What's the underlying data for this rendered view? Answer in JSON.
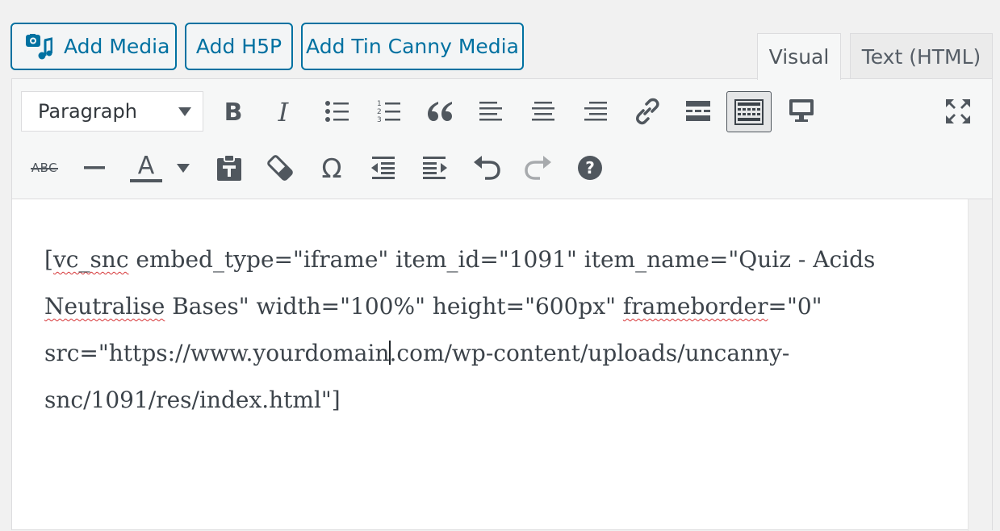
{
  "media_buttons": {
    "add_media": "Add Media",
    "add_h5p": "Add H5P",
    "add_tin_canny": "Add Tin Canny Media"
  },
  "tabs": {
    "visual": "Visual",
    "text": "Text (HTML)"
  },
  "toolbar": {
    "format_select": "Paragraph",
    "row1_icons": [
      "bold-icon",
      "italic-icon",
      "bulleted-list-icon",
      "numbered-list-icon",
      "blockquote-icon",
      "align-left-icon",
      "align-center-icon",
      "align-right-icon",
      "link-icon",
      "read-more-icon",
      "toolbar-toggle-icon",
      "fullscreen-preview-icon",
      "fullscreen-icon"
    ],
    "row2_icons": [
      "strikethrough-icon",
      "horizontal-line-icon",
      "text-color-icon",
      "text-color-dropdown-icon",
      "paste-as-text-icon",
      "clear-formatting-icon",
      "special-character-icon",
      "outdent-icon",
      "indent-icon",
      "undo-icon",
      "redo-icon",
      "help-icon"
    ],
    "strike_label": "ABC",
    "text_color_label": "A",
    "omega_label": "Ω",
    "help_label": "?"
  },
  "content": {
    "line1_a": "[",
    "line1_spell": "vc_snc",
    "line1_b": " embed_type=\"iframe\" item_id=\"1091\" item_name=\"Quiz - Acids",
    "line2_spell": "Neutralise",
    "line2_a": " Bases\" width=\"100%\" height=\"600px\" ",
    "line2_spell2": "frameborder",
    "line2_b": "=\"0\"",
    "line3_a": "src=\"https://www.yourdomain",
    "line3_b": ".com/wp-content/uploads/uncanny-",
    "line4": "snc/1091/res/index.html\"]"
  },
  "colors": {
    "accent": "#0071a1",
    "icon": "#50575e",
    "disabled_icon": "#a7aaad",
    "spellcheck": "#d63638"
  }
}
